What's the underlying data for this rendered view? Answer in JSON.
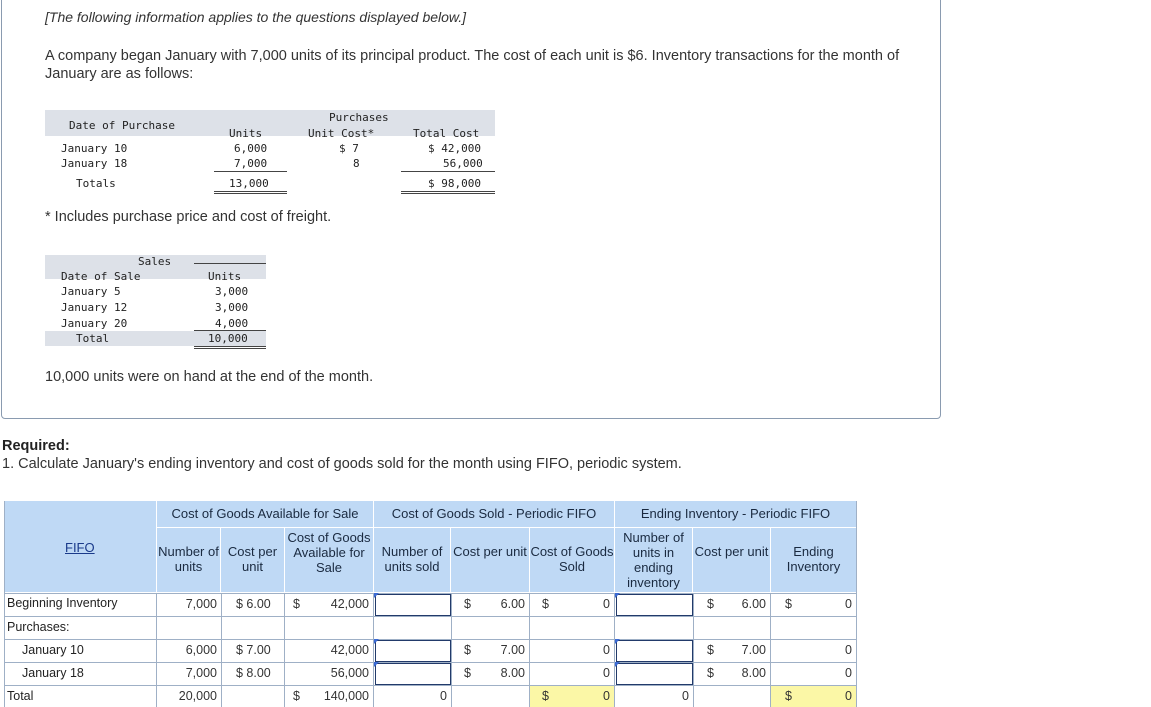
{
  "intro": "[The following information applies to the questions displayed below.]",
  "paragraph": "A company began January with 7,000 units of its principal product. The cost of each unit is $6. Inventory transactions for the month of January are as follows:",
  "purchases_table": {
    "group_header": "Purchases",
    "col_date": "Date of Purchase",
    "col_units": "Units",
    "col_unit_cost": "Unit Cost*",
    "col_total_cost": "Total Cost",
    "rows": [
      {
        "date": "January 10",
        "units": "6,000",
        "unit_cost": "$ 7",
        "total_cost": "$ 42,000"
      },
      {
        "date": "January 18",
        "units": "7,000",
        "unit_cost": "8",
        "total_cost": "56,000"
      }
    ],
    "totals_label": "Totals",
    "totals_units": "13,000",
    "totals_cost": "$ 98,000"
  },
  "footnote": "* Includes purchase price and cost of freight.",
  "sales_table": {
    "group_header": "Sales",
    "col_date": "Date of Sale",
    "col_units": "Units",
    "rows": [
      {
        "date": "January 5",
        "units": "3,000"
      },
      {
        "date": "January 12",
        "units": "3,000"
      },
      {
        "date": "January 20",
        "units": "4,000"
      }
    ],
    "total_label": "Total",
    "total_units": "10,000"
  },
  "end_note": "10,000 units were on hand at the end of the month.",
  "required_label": "Required:",
  "question": "1. Calculate January's ending inventory and cost of goods sold for the month using FIFO, periodic system.",
  "answer_table": {
    "fifo_link": "FIFO",
    "group_cogas": "Cost of Goods Available for Sale",
    "group_cogs": "Cost of Goods Sold - Periodic FIFO",
    "group_ei": "Ending Inventory - Periodic FIFO",
    "h_units": "Number of units",
    "h_cost_per_unit": "Cost per unit",
    "h_cogas": "Cost of Goods Available for Sale",
    "h_units_sold": "Number of units sold",
    "h_cogs_cpu": "Cost per unit",
    "h_cogs": "Cost of Goods Sold",
    "h_ei_units": "Number of units in ending inventory",
    "h_ei_cpu": "Cost per unit",
    "h_ei": "Ending Inventory",
    "rows": {
      "beginning": {
        "label": "Beginning Inventory",
        "units": "7,000",
        "cpu": "$ 6.00",
        "cogas_sym": "$",
        "cogas": "42,000",
        "cogs_sym": "$",
        "cogs_cpu": "6.00",
        "cogs_val_sym": "$",
        "cogs": "0",
        "ei_sym": "$",
        "ei_cpu": "6.00",
        "ei_val_sym": "$",
        "ei": "0"
      },
      "purchases_label": "Purchases:",
      "jan10": {
        "label": "January 10",
        "units": "6,000",
        "cpu": "$ 7.00",
        "cogas": "42,000",
        "cogs_sym": "$",
        "cogs_cpu": "7.00",
        "cogs": "0",
        "ei_sym": "$",
        "ei_cpu": "7.00",
        "ei": "0"
      },
      "jan18": {
        "label": "January 18",
        "units": "7,000",
        "cpu": "$ 8.00",
        "cogas": "56,000",
        "cogs_sym": "$",
        "cogs_cpu": "8.00",
        "cogs": "0",
        "ei_sym": "$",
        "ei_cpu": "8.00",
        "ei": "0"
      },
      "total": {
        "label": "Total",
        "units": "20,000",
        "cogas_sym": "$",
        "cogas": "140,000",
        "units_sold": "0",
        "cogs_sym": "$",
        "cogs": "0",
        "ei_units": "0",
        "ei_sym": "$",
        "ei": "0"
      }
    }
  }
}
